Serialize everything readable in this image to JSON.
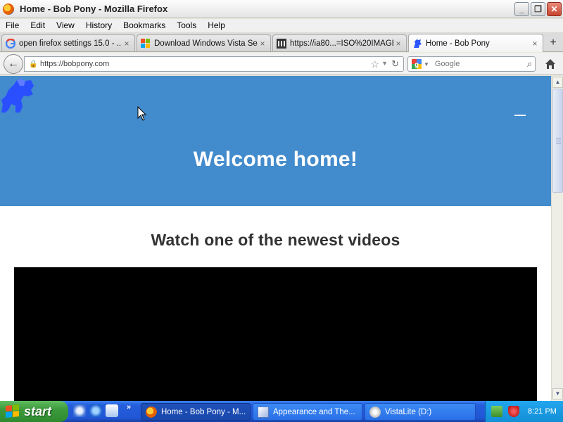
{
  "window": {
    "title": "Home - Bob Pony - Mozilla Firefox",
    "buttons": {
      "minimize": "_",
      "maximize": "❐",
      "close": "✕"
    }
  },
  "menu": [
    "File",
    "Edit",
    "View",
    "History",
    "Bookmarks",
    "Tools",
    "Help"
  ],
  "tabs": [
    {
      "label": "open firefox settings 15.0 - ...",
      "icon": "google-icon",
      "active": false
    },
    {
      "label": "Download Windows Vista Ser...",
      "icon": "windows-icon",
      "active": false
    },
    {
      "label": "https://ia80...=ISO%20IMAGE",
      "icon": "archive-icon",
      "active": false
    },
    {
      "label": "Home - Bob Pony",
      "icon": "bobpony-icon",
      "active": true
    }
  ],
  "tab_close": "×",
  "new_tab": "+",
  "navbar": {
    "url": "https://bobpony.com",
    "search_placeholder": "Google"
  },
  "page": {
    "hero_title": "Welcome home!",
    "section_title": "Watch one of the newest videos",
    "hero_color": "#428bcc"
  },
  "taskbar": {
    "start_label": "start",
    "tasks": [
      {
        "label": "Home - Bob Pony - M...",
        "icon": "firefox-icon",
        "active": true
      },
      {
        "label": "Appearance and The...",
        "icon": "control-panel-icon",
        "active": false
      },
      {
        "label": "VistaLite (D:)",
        "icon": "drive-icon",
        "active": false
      }
    ],
    "clock": "8:21 PM"
  }
}
